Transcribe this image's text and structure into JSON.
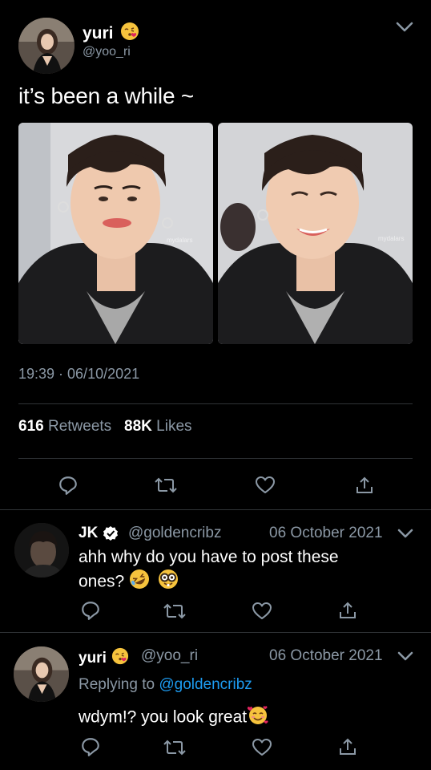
{
  "main_tweet": {
    "author_name": "yuri",
    "author_emoji": "😘",
    "handle": "@yoo_ri",
    "text": "it’s been a while ~",
    "time": "19:39 · 06/10/2021",
    "retweets_count": "616",
    "retweets_label": "Retweets",
    "likes_count": "88K",
    "likes_label": "Likes",
    "photo_watermark_1": "mydalars",
    "photo_watermark_2": "mydalars"
  },
  "replies": [
    {
      "author_name": "JK",
      "verified": true,
      "handle": "@goldencribz",
      "date": "06 October 2021",
      "text_line1": "ahh why do you have to post these",
      "text_line2": "ones?",
      "emojis": [
        "🤣",
        "🤓"
      ]
    },
    {
      "author_name": "yuri",
      "author_emoji": "😘",
      "handle": "@yoo_ri",
      "date": "06 October 2021",
      "replying_prefix": "Replying to",
      "replying_to": "@goldencribz",
      "text": "wdym!? you look great",
      "emoji": "🥰"
    }
  ],
  "colors": {
    "background": "#000000",
    "muted": "#8b98a5",
    "link": "#1d9bf0",
    "divider": "#2f3336"
  }
}
